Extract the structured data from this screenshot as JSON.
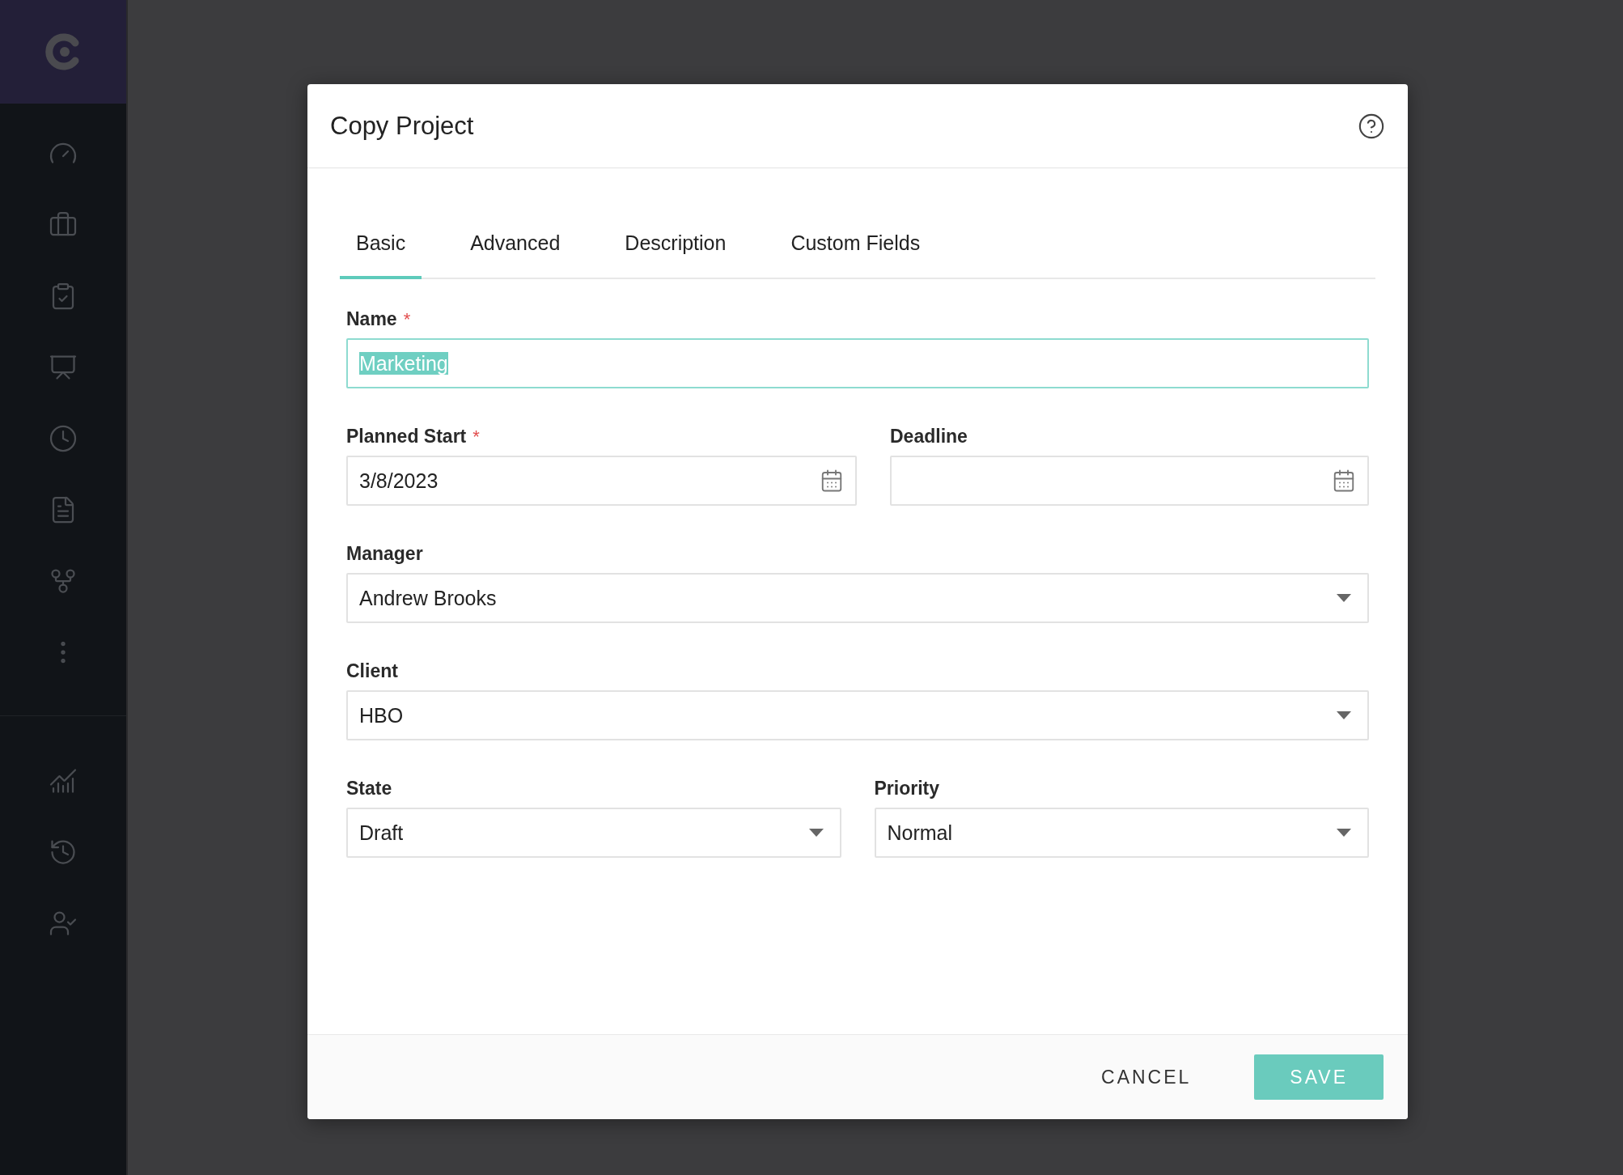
{
  "dialog": {
    "title": "Copy Project",
    "tabs": [
      {
        "label": "Basic",
        "selected": true
      },
      {
        "label": "Advanced",
        "selected": false
      },
      {
        "label": "Description",
        "selected": false
      },
      {
        "label": "Custom Fields",
        "selected": false
      }
    ],
    "rows": [
      [
        {
          "kind": "text",
          "label": "Name",
          "required_mark": "*",
          "value": "Marketing",
          "focused": true,
          "highlighted": true
        }
      ],
      [
        {
          "kind": "date",
          "label": "Planned Start",
          "required_mark": "*",
          "value": "3/8/2023"
        },
        {
          "kind": "date",
          "label": "Deadline"
        }
      ],
      [
        {
          "kind": "select",
          "label": "Manager",
          "value": "Andrew Brooks"
        }
      ],
      [
        {
          "kind": "select",
          "label": "Client",
          "value": "HBO"
        }
      ],
      [
        {
          "kind": "select",
          "label": "State",
          "value": "Draft"
        },
        {
          "kind": "select",
          "label": "Priority",
          "value": "Normal"
        }
      ]
    ],
    "buttons": [
      {
        "kind": "flat",
        "label": "CANCEL"
      },
      {
        "kind": "primary",
        "label": "SAVE"
      }
    ]
  }
}
